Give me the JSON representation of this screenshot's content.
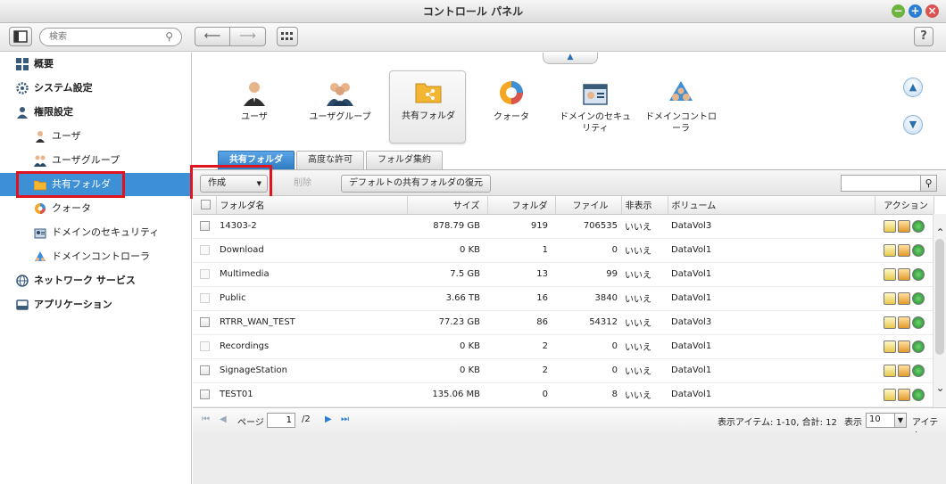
{
  "window": {
    "title": "コントロール パネル"
  },
  "toolbar": {
    "search_placeholder": "検索",
    "help_label": "?"
  },
  "sidebar": {
    "items": [
      {
        "label": "概要"
      },
      {
        "label": "システム設定"
      },
      {
        "label": "権限設定"
      },
      {
        "label": "ユーザ"
      },
      {
        "label": "ユーザグループ"
      },
      {
        "label": "共有フォルダ"
      },
      {
        "label": "クォータ"
      },
      {
        "label": "ドメインのセキュリティ"
      },
      {
        "label": "ドメインコントローラ"
      },
      {
        "label": "ネットワーク サービス"
      },
      {
        "label": "アプリケーション"
      }
    ]
  },
  "categories": [
    {
      "label": "ユーザ"
    },
    {
      "label": "ユーザグループ"
    },
    {
      "label": "共有フォルダ"
    },
    {
      "label": "クォータ"
    },
    {
      "label": "ドメインのセキュリティ"
    },
    {
      "label": "ドメインコントローラ"
    }
  ],
  "tabs": [
    {
      "label": "共有フォルダ"
    },
    {
      "label": "高度な許可"
    },
    {
      "label": "フォルダ集約"
    }
  ],
  "actions": {
    "create_label": "作成",
    "delete_label": "削除",
    "restore_label": "デフォルトの共有フォルダの復元"
  },
  "table": {
    "columns": [
      "フォルダ名",
      "サイズ",
      "フォルダ",
      "ファイル",
      "非表示",
      "ボリューム",
      "アクション"
    ],
    "rows": [
      {
        "name": "14303-2",
        "size": "878.79 GB",
        "folders": "919",
        "files": "706535",
        "hidden": "いいえ",
        "volume": "DataVol3"
      },
      {
        "name": "Download",
        "size": "0 KB",
        "folders": "1",
        "files": "0",
        "hidden": "いいえ",
        "volume": "DataVol1"
      },
      {
        "name": "Multimedia",
        "size": "7.5 GB",
        "folders": "13",
        "files": "99",
        "hidden": "いいえ",
        "volume": "DataVol1"
      },
      {
        "name": "Public",
        "size": "3.66 TB",
        "folders": "16",
        "files": "3840",
        "hidden": "いいえ",
        "volume": "DataVol1"
      },
      {
        "name": "RTRR_WAN_TEST",
        "size": "77.23 GB",
        "folders": "86",
        "files": "54312",
        "hidden": "いいえ",
        "volume": "DataVol3"
      },
      {
        "name": "Recordings",
        "size": "0 KB",
        "folders": "2",
        "files": "0",
        "hidden": "いいえ",
        "volume": "DataVol1"
      },
      {
        "name": "SignageStation",
        "size": "0 KB",
        "folders": "2",
        "files": "0",
        "hidden": "いいえ",
        "volume": "DataVol1"
      },
      {
        "name": "TEST01",
        "size": "135.06 MB",
        "folders": "0",
        "files": "8",
        "hidden": "いいえ",
        "volume": "DataVol1"
      }
    ]
  },
  "pager": {
    "page_label": "ページ",
    "current_page": "1",
    "total_pages": "/2",
    "summary": "表示アイテム: 1-10, 合計: 12",
    "show_label": "表示",
    "per_page": "10",
    "items_label": "アイテム"
  },
  "colors": {
    "accent": "#3d8fd6",
    "highlight": "#e0141e"
  }
}
